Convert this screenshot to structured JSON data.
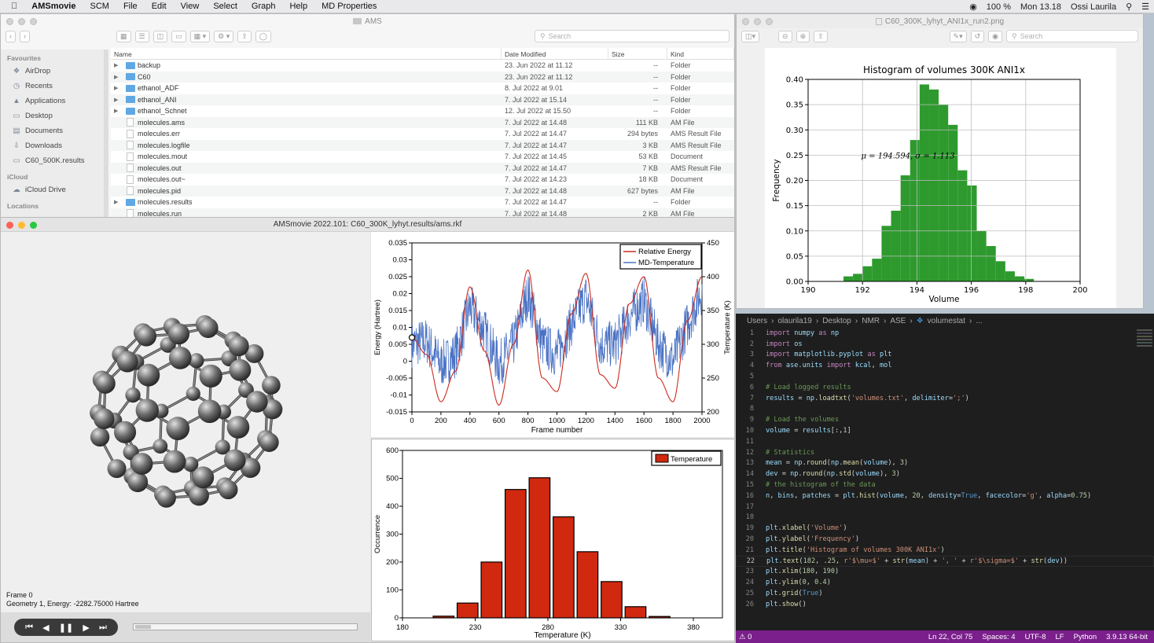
{
  "menubar": {
    "app": "AMSmovie",
    "items": [
      "SCM",
      "File",
      "Edit",
      "View",
      "Select",
      "Graph",
      "Help",
      "MD Properties"
    ],
    "battery": "100 %",
    "clock": "Mon 13.18",
    "user": "Ossi Laurila"
  },
  "finder": {
    "title": "AMS",
    "search_placeholder": "Search",
    "sidebar": {
      "favourites_label": "Favourites",
      "items": [
        "AirDrop",
        "Recents",
        "Applications",
        "Desktop",
        "Documents",
        "Downloads",
        "C60_500K.results"
      ],
      "icloud_label": "iCloud",
      "icloud_items": [
        "iCloud Drive"
      ],
      "locations_label": "Locations"
    },
    "columns": [
      "Name",
      "Date Modified",
      "Size",
      "Kind"
    ],
    "rows": [
      {
        "name": "backup",
        "date": "23. Jun 2022 at 11.12",
        "size": "--",
        "kind": "Folder",
        "folder": true
      },
      {
        "name": "C60",
        "date": "23. Jun 2022 at 11.12",
        "size": "--",
        "kind": "Folder",
        "folder": true
      },
      {
        "name": "ethanol_ADF",
        "date": "8. Jul 2022 at 9.01",
        "size": "--",
        "kind": "Folder",
        "folder": true
      },
      {
        "name": "ethanol_ANI",
        "date": "7. Jul 2022 at 15.14",
        "size": "--",
        "kind": "Folder",
        "folder": true
      },
      {
        "name": "ethanol_Schnet",
        "date": "12. Jul 2022 at 15.50",
        "size": "--",
        "kind": "Folder",
        "folder": true
      },
      {
        "name": "molecules.ams",
        "date": "7. Jul 2022 at 14.48",
        "size": "111 KB",
        "kind": "AM File",
        "folder": false
      },
      {
        "name": "molecules.err",
        "date": "7. Jul 2022 at 14.47",
        "size": "294 bytes",
        "kind": "AMS Result File",
        "folder": false
      },
      {
        "name": "molecules.logfile",
        "date": "7. Jul 2022 at 14.47",
        "size": "3 KB",
        "kind": "AMS Result File",
        "folder": false
      },
      {
        "name": "molecules.mout",
        "date": "7. Jul 2022 at 14.45",
        "size": "53 KB",
        "kind": "Document",
        "folder": false
      },
      {
        "name": "molecules.out",
        "date": "7. Jul 2022 at 14.47",
        "size": "7 KB",
        "kind": "AMS Result File",
        "folder": false
      },
      {
        "name": "molecules.out~",
        "date": "7. Jul 2022 at 14.23",
        "size": "18 KB",
        "kind": "Document",
        "folder": false
      },
      {
        "name": "molecules.pid",
        "date": "7. Jul 2022 at 14.48",
        "size": "627 bytes",
        "kind": "AM File",
        "folder": false
      },
      {
        "name": "molecules.results",
        "date": "7. Jul 2022 at 14.47",
        "size": "--",
        "kind": "Folder",
        "folder": true
      },
      {
        "name": "molecules.run",
        "date": "7. Jul 2022 at 14.48",
        "size": "2 KB",
        "kind": "AM File",
        "folder": false
      }
    ]
  },
  "ams": {
    "title": "AMSmovie 2022.101: C60_300K_lyhyt.results/ams.rkf",
    "frame_label": "Frame 0",
    "geometry_label": "Geometry 1, Energy: -2282.75000 Hartree"
  },
  "preview": {
    "title": "C60_300K_lyhyt_ANI1x_run2.png",
    "search_placeholder": "Search"
  },
  "chart_data": [
    {
      "type": "line",
      "title": "",
      "xlabel": "Frame number",
      "ylabel": "Energy (Hartree)",
      "y2label": "Temperature (K)",
      "xlim": [
        0,
        2000
      ],
      "ylim": [
        -0.015,
        0.035
      ],
      "y2lim": [
        200,
        450
      ],
      "xticks": [
        0,
        200,
        400,
        600,
        800,
        1000,
        1200,
        1400,
        1600,
        1800,
        2000
      ],
      "yticks": [
        "-0.015",
        "-0.01",
        "-0.005",
        "0",
        "0.005",
        "0.01",
        "0.015",
        "0.02",
        "0.025",
        "0.03",
        "0.035"
      ],
      "y2ticks": [
        200,
        250,
        300,
        350,
        400,
        450
      ],
      "legend": "top-right",
      "series": [
        {
          "name": "Relative Energy",
          "color": "#cc2a1e",
          "axis": "left",
          "x": [
            0,
            100,
            200,
            300,
            400,
            500,
            600,
            700,
            800,
            900,
            1000,
            1100,
            1200,
            1300,
            1400,
            1500,
            1600,
            1700,
            1800,
            1900,
            2000
          ],
          "values": [
            0.007,
            0.002,
            -0.012,
            -0.003,
            0.022,
            0.003,
            -0.013,
            0.005,
            0.027,
            -0.005,
            -0.009,
            0.014,
            0.026,
            -0.004,
            -0.008,
            0.017,
            0.025,
            -0.005,
            -0.012,
            0.012,
            0.025
          ]
        },
        {
          "name": "MD-Temperature",
          "color": "#4a72c4",
          "axis": "right",
          "x": [
            0,
            100,
            200,
            300,
            400,
            500,
            600,
            700,
            800,
            900,
            1000,
            1100,
            1200,
            1300,
            1400,
            1500,
            1600,
            1700,
            1800,
            1900,
            2000
          ],
          "values": [
            300,
            305,
            270,
            285,
            355,
            320,
            270,
            300,
            375,
            300,
            285,
            330,
            370,
            300,
            300,
            340,
            365,
            300,
            275,
            330,
            380
          ]
        }
      ]
    },
    {
      "type": "bar",
      "title": "",
      "xlabel": "Temperature (K)",
      "ylabel": "Occurrence",
      "xlim": [
        180,
        400
      ],
      "ylim": [
        0,
        600
      ],
      "xticks": [
        180,
        230,
        280,
        330,
        380
      ],
      "yticks": [
        0,
        100,
        200,
        300,
        400,
        500,
        600
      ],
      "legend": "top-right",
      "series": [
        {
          "name": "Temperature",
          "color": "#d0290f"
        }
      ],
      "bin_edges": [
        200,
        216.5,
        233,
        249.5,
        266,
        282.5,
        299,
        315.5,
        332,
        348.5,
        365,
        381.5,
        398
      ],
      "values": [
        6,
        53,
        200,
        460,
        502,
        362,
        237,
        130,
        40,
        5,
        0,
        0
      ]
    },
    {
      "type": "bar",
      "title": "Histogram of volumes 300K ANI1x",
      "xlabel": "Volume",
      "ylabel": "Frequency",
      "xlim": [
        190,
        200
      ],
      "ylim": [
        0,
        0.4
      ],
      "xticks": [
        190,
        192,
        194,
        196,
        198,
        200
      ],
      "yticks": [
        "0.00",
        "0.05",
        "0.10",
        "0.15",
        "0.20",
        "0.25",
        "0.30",
        "0.35",
        "0.40"
      ],
      "grid": true,
      "annotation": "μ = 194.594, σ = 1.113",
      "series": [
        {
          "color": "#2e9a2e"
        }
      ],
      "bin_edges": [
        191.3,
        191.65,
        192.0,
        192.35,
        192.7,
        193.05,
        193.4,
        193.75,
        194.1,
        194.45,
        194.8,
        195.15,
        195.5,
        195.85,
        196.2,
        196.55,
        196.9,
        197.25,
        197.6,
        197.95,
        198.3
      ],
      "values": [
        0.01,
        0.015,
        0.03,
        0.045,
        0.11,
        0.14,
        0.21,
        0.28,
        0.39,
        0.38,
        0.35,
        0.31,
        0.22,
        0.19,
        0.1,
        0.07,
        0.04,
        0.02,
        0.01,
        0.005
      ]
    }
  ],
  "editor": {
    "breadcrumb": [
      "Users",
      "olaurila19",
      "Desktop",
      "NMR",
      "ASE",
      "volumestat",
      "..."
    ],
    "lines": [
      "import numpy as np",
      "import os",
      "import matplotlib.pyplot as plt",
      "from ase.units import kcal, mol",
      "",
      "# Load logged results",
      "results = np.loadtxt('volumes.txt', delimiter=';')",
      "",
      "# Load the volumes",
      "volume = results[:,1]",
      "",
      "# Statistics",
      "mean = np.round(np.mean(volume), 3)",
      "dev = np.round(np.std(volume), 3)",
      "# the histogram of the data",
      "n, bins, patches = plt.hist(volume, 20, density=True, facecolor='g', alpha=0.75)",
      "",
      "",
      "plt.xlabel('Volume')",
      "plt.ylabel('Frequency')",
      "plt.title('Histogram of volumes 300K ANI1x')",
      "plt.text(182, .25, r'$\\mu=$' + str(mean) + ', ' + r'$\\sigma=$' + str(dev))",
      "plt.xlim(180, 190)",
      "plt.ylim(0, 0.4)",
      "plt.grid(True)",
      "plt.show()"
    ],
    "current_line": 22,
    "status": {
      "problems": "0",
      "position": "Ln 22, Col 75",
      "spaces": "Spaces: 4",
      "encoding": "UTF-8",
      "eol": "LF",
      "language": "Python",
      "interpreter": "3.9.13 64-bit"
    }
  }
}
